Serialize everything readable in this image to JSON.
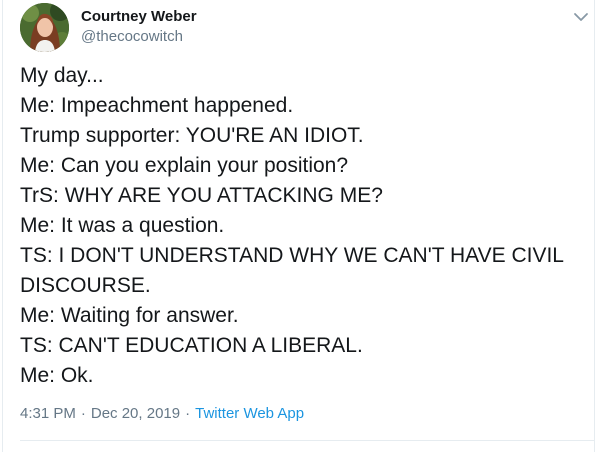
{
  "author": {
    "display_name": "Courtney Weber",
    "handle": "@thecocowitch",
    "avatar_icon": "profile-photo"
  },
  "menu": {
    "icon": "chevron-down-icon"
  },
  "tweet": {
    "lines": [
      "My day...",
      "Me: Impeachment happened.",
      "Trump supporter: YOU'RE AN IDIOT.",
      "Me: Can you explain your position?",
      "TrS: WHY ARE YOU ATTACKING ME?",
      "Me: It was a question.",
      "TS: I DON'T UNDERSTAND WHY WE CAN'T HAVE CIVIL",
      "DISCOURSE.",
      "Me: Waiting for answer.",
      "TS: CAN'T EDUCATION A LIBERAL.",
      "Me: Ok."
    ]
  },
  "meta": {
    "time": "4:31 PM",
    "separator": "·",
    "date": "Dec 20, 2019",
    "source": "Twitter Web App"
  },
  "colors": {
    "text": "#14171a",
    "secondary": "#657786",
    "link": "#1b95e0",
    "border": "#e6ecf0"
  }
}
